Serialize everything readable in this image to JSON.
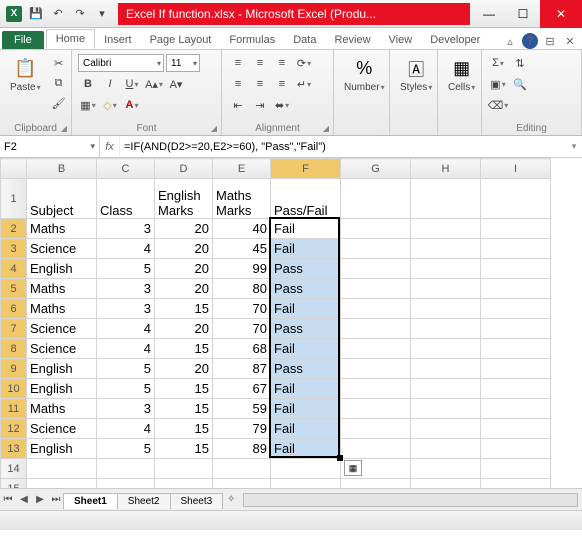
{
  "title": "Excel If function.xlsx - Microsoft Excel (Produ...",
  "tabs": {
    "file": "File",
    "home": "Home",
    "insert": "Insert",
    "page_layout": "Page Layout",
    "formulas": "Formulas",
    "data": "Data",
    "review": "Review",
    "view": "View",
    "developer": "Developer"
  },
  "ribbon": {
    "clipboard": "Clipboard",
    "paste": "Paste",
    "font_group": "Font",
    "font_name": "Calibri",
    "font_size": "11",
    "alignment": "Alignment",
    "number": "Number",
    "styles": "Styles",
    "cells": "Cells",
    "editing": "Editing"
  },
  "namebox": "F2",
  "formula": "=IF(AND(D2>=20,E2>=60), \"Pass\",\"Fail\")",
  "columns": [
    "B",
    "C",
    "D",
    "E",
    "F",
    "G",
    "H",
    "I"
  ],
  "headers": {
    "b": "Subject",
    "c": "Class",
    "d": "English Marks",
    "e": "Maths Marks",
    "f": "Pass/Fail"
  },
  "rows": [
    {
      "n": 2,
      "b": "Maths",
      "c": 3,
      "d": 20,
      "e": 40,
      "f": "Fail"
    },
    {
      "n": 3,
      "b": "Science",
      "c": 4,
      "d": 20,
      "e": 45,
      "f": "Fail"
    },
    {
      "n": 4,
      "b": "English",
      "c": 5,
      "d": 20,
      "e": 99,
      "f": "Pass"
    },
    {
      "n": 5,
      "b": "Maths",
      "c": 3,
      "d": 20,
      "e": 80,
      "f": "Pass"
    },
    {
      "n": 6,
      "b": "Maths",
      "c": 3,
      "d": 15,
      "e": 70,
      "f": "Fail"
    },
    {
      "n": 7,
      "b": "Science",
      "c": 4,
      "d": 20,
      "e": 70,
      "f": "Pass"
    },
    {
      "n": 8,
      "b": "Science",
      "c": 4,
      "d": 15,
      "e": 68,
      "f": "Fail"
    },
    {
      "n": 9,
      "b": "English",
      "c": 5,
      "d": 20,
      "e": 87,
      "f": "Pass"
    },
    {
      "n": 10,
      "b": "English",
      "c": 5,
      "d": 15,
      "e": 67,
      "f": "Fail"
    },
    {
      "n": 11,
      "b": "Maths",
      "c": 3,
      "d": 15,
      "e": 59,
      "f": "Fail"
    },
    {
      "n": 12,
      "b": "Science",
      "c": 4,
      "d": 15,
      "e": 79,
      "f": "Fail"
    },
    {
      "n": 13,
      "b": "English",
      "c": 5,
      "d": 15,
      "e": 89,
      "f": "Fail"
    }
  ],
  "sheets": [
    "Sheet1",
    "Sheet2",
    "Sheet3"
  ],
  "smart_tag": "▦"
}
